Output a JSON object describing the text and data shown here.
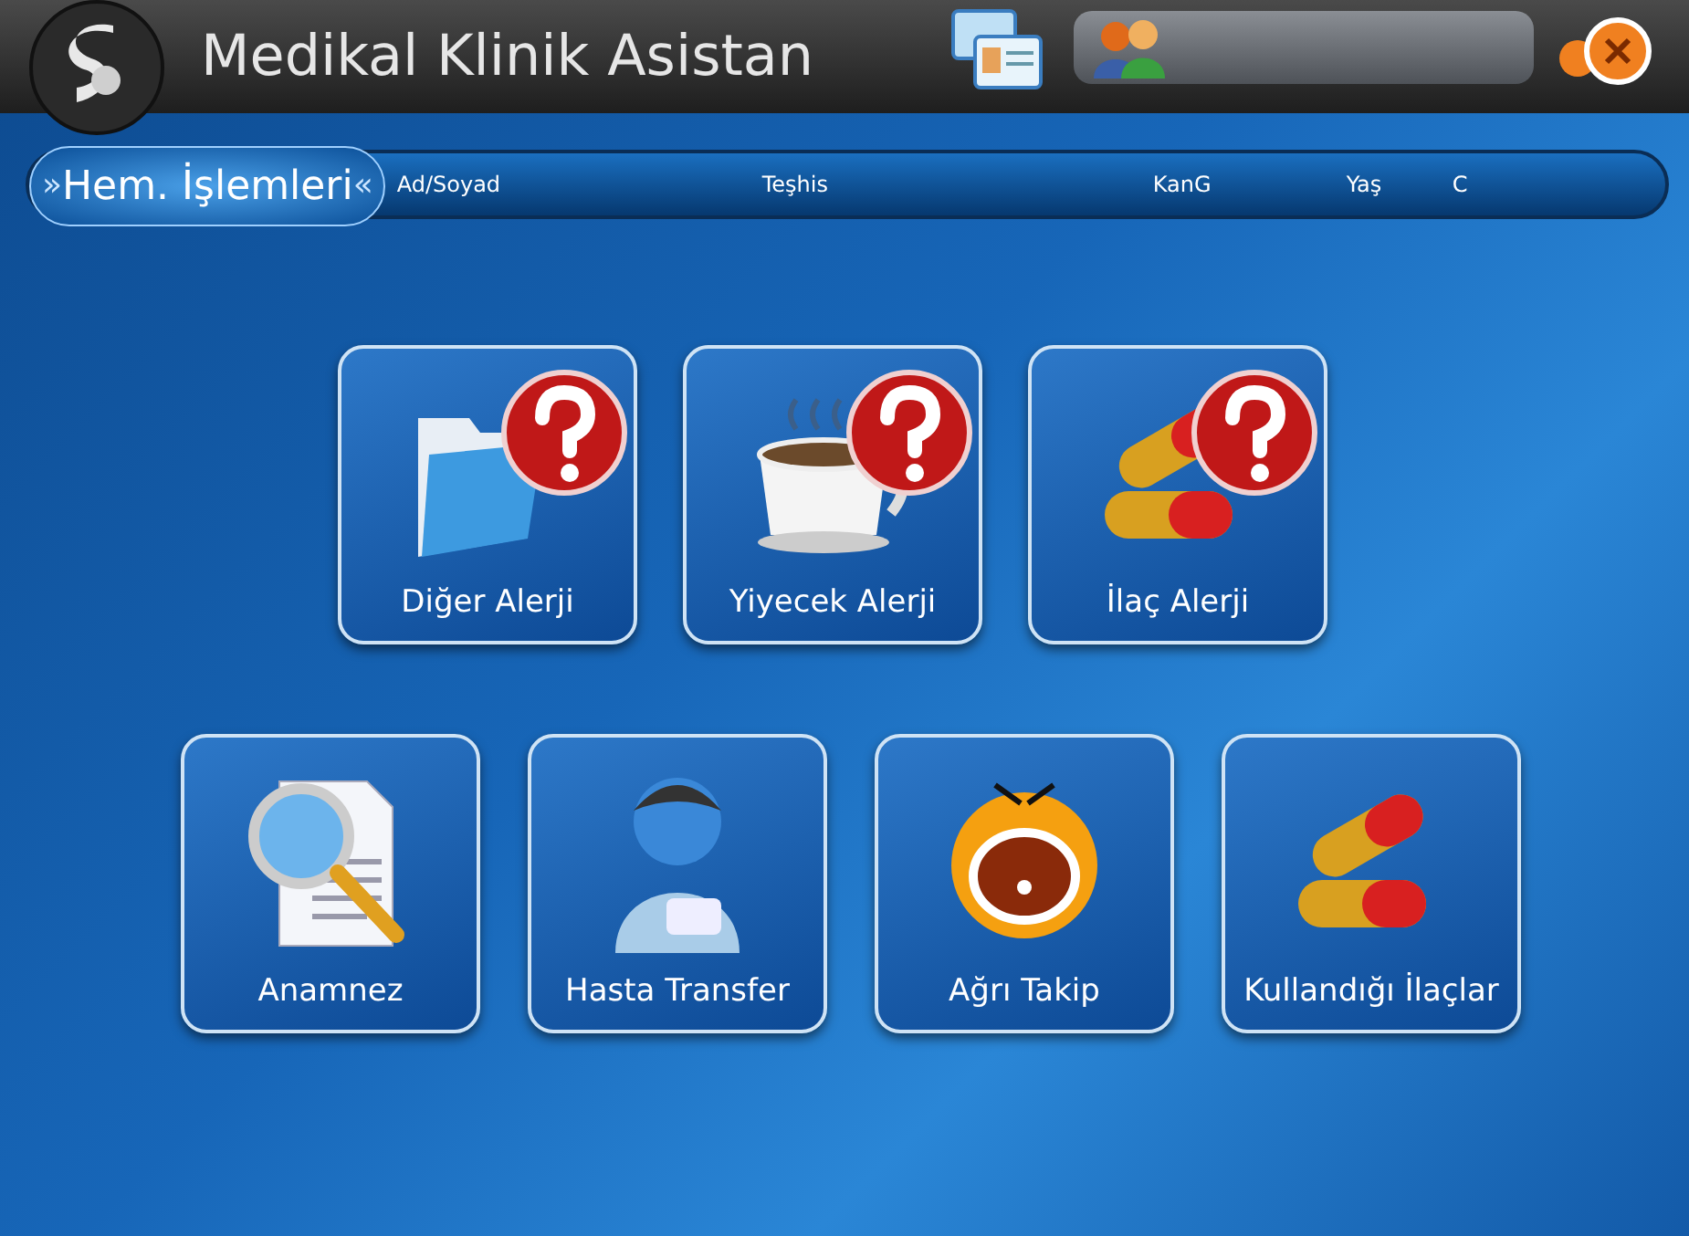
{
  "header": {
    "title": "Medikal Klinik Asistan"
  },
  "info_bar": {
    "label": "Hem. İşlemleri",
    "left_mark": "»",
    "right_mark": "«",
    "columns": [
      "Ad/Soyad",
      "Teşhis",
      "KanG",
      "Yaş",
      "C"
    ]
  },
  "tile_rows": [
    {
      "tiles": [
        {
          "label": "Diğer Alerji",
          "kind": "folder",
          "question_badge": true
        },
        {
          "label": "Yiyecek Alerji",
          "kind": "cup",
          "question_badge": true
        },
        {
          "label": "İlaç Alerji",
          "kind": "pills",
          "question_badge": true
        }
      ]
    },
    {
      "tiles": [
        {
          "label": "Anamnez",
          "kind": "magnifier",
          "question_badge": false
        },
        {
          "label": "Hasta Transfer",
          "kind": "patient",
          "question_badge": false
        },
        {
          "label": "Ağrı Takip",
          "kind": "face",
          "question_badge": false
        },
        {
          "label": "Kullandığı İlaçlar",
          "kind": "pills",
          "question_badge": false
        }
      ]
    }
  ]
}
